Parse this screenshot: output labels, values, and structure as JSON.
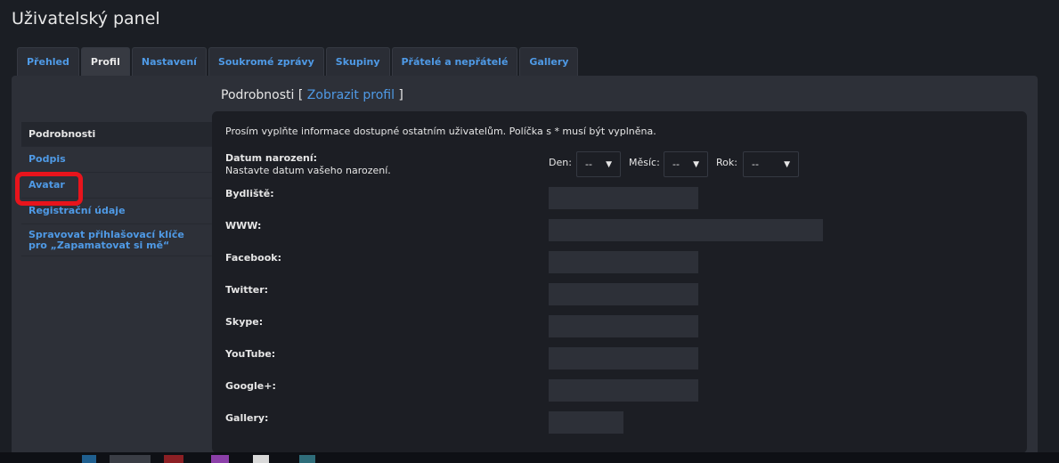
{
  "page": {
    "title": "Uživatelský panel"
  },
  "tabs": [
    {
      "label": "Přehled"
    },
    {
      "label": "Profil"
    },
    {
      "label": "Nastavení"
    },
    {
      "label": "Soukromé zprávy"
    },
    {
      "label": "Skupiny"
    },
    {
      "label": "Přátelé a nepřátelé"
    },
    {
      "label": "Gallery"
    }
  ],
  "menu": {
    "items": [
      {
        "label": "Podrobnosti"
      },
      {
        "label": "Podpis"
      },
      {
        "label": "Avatar"
      },
      {
        "label": "Registrační údaje"
      },
      {
        "label": "Spravovat přihlašovací klíče pro „Zapamatovat si mě“"
      }
    ]
  },
  "section": {
    "title": "Podrobnosti",
    "bracket_open": "[",
    "link": "Zobrazit profil",
    "bracket_close": "]",
    "intro": "Prosím vyplňte informace dostupné ostatním uživatelům. Políčka s * musí být vyplněna."
  },
  "birth": {
    "label": "Datum narození:",
    "hint": "Nastavte datum vašeho narození.",
    "day_label": "Den:",
    "day_value": "--",
    "month_label": "Měsíc:",
    "month_value": "--",
    "year_label": "Rok:",
    "year_value": "--"
  },
  "fields": {
    "location": {
      "label": "Bydliště:",
      "value": ""
    },
    "www": {
      "label": "WWW:",
      "value": ""
    },
    "facebook": {
      "label": "Facebook:",
      "value": ""
    },
    "twitter": {
      "label": "Twitter:",
      "value": ""
    },
    "skype": {
      "label": "Skype:",
      "value": ""
    },
    "youtube": {
      "label": "YouTube:",
      "value": ""
    },
    "googleplus": {
      "label": "Google+:",
      "value": ""
    },
    "gallery": {
      "label": "Gallery:",
      "value": ""
    }
  },
  "colors": {
    "accent": "#4f9ae6",
    "annotation": "#e8141c"
  }
}
